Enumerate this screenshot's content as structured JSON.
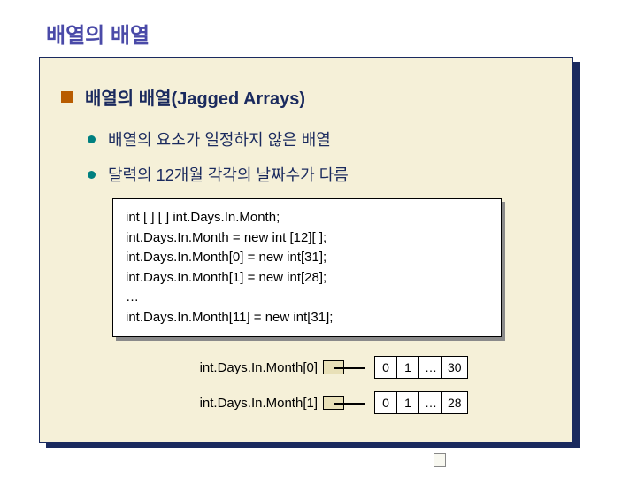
{
  "title": "배열의 배열",
  "heading": "배열의 배열(Jagged Arrays)",
  "bullets": [
    "배열의 요소가 일정하지 않은 배열",
    "달력의 12개월 각각의 날짜수가 다름"
  ],
  "code": {
    "l1": "int [ ] [ ] int.Days.In.Month;",
    "l2": "int.Days.In.Month = new int [12][ ];",
    "l3": "int.Days.In.Month[0] = new int[31];",
    "l4": "int.Days.In.Month[1] = new int[28];",
    "l5": "…",
    "l6": "int.Days.In.Month[11] = new int[31];"
  },
  "diagram": {
    "rows": [
      {
        "label": "int.Days.In.Month[0]",
        "cells": [
          "0",
          "1",
          "…",
          "30"
        ]
      },
      {
        "label": "int.Days.In.Month[1]",
        "cells": [
          "0",
          "1",
          "…",
          "28"
        ]
      }
    ]
  }
}
